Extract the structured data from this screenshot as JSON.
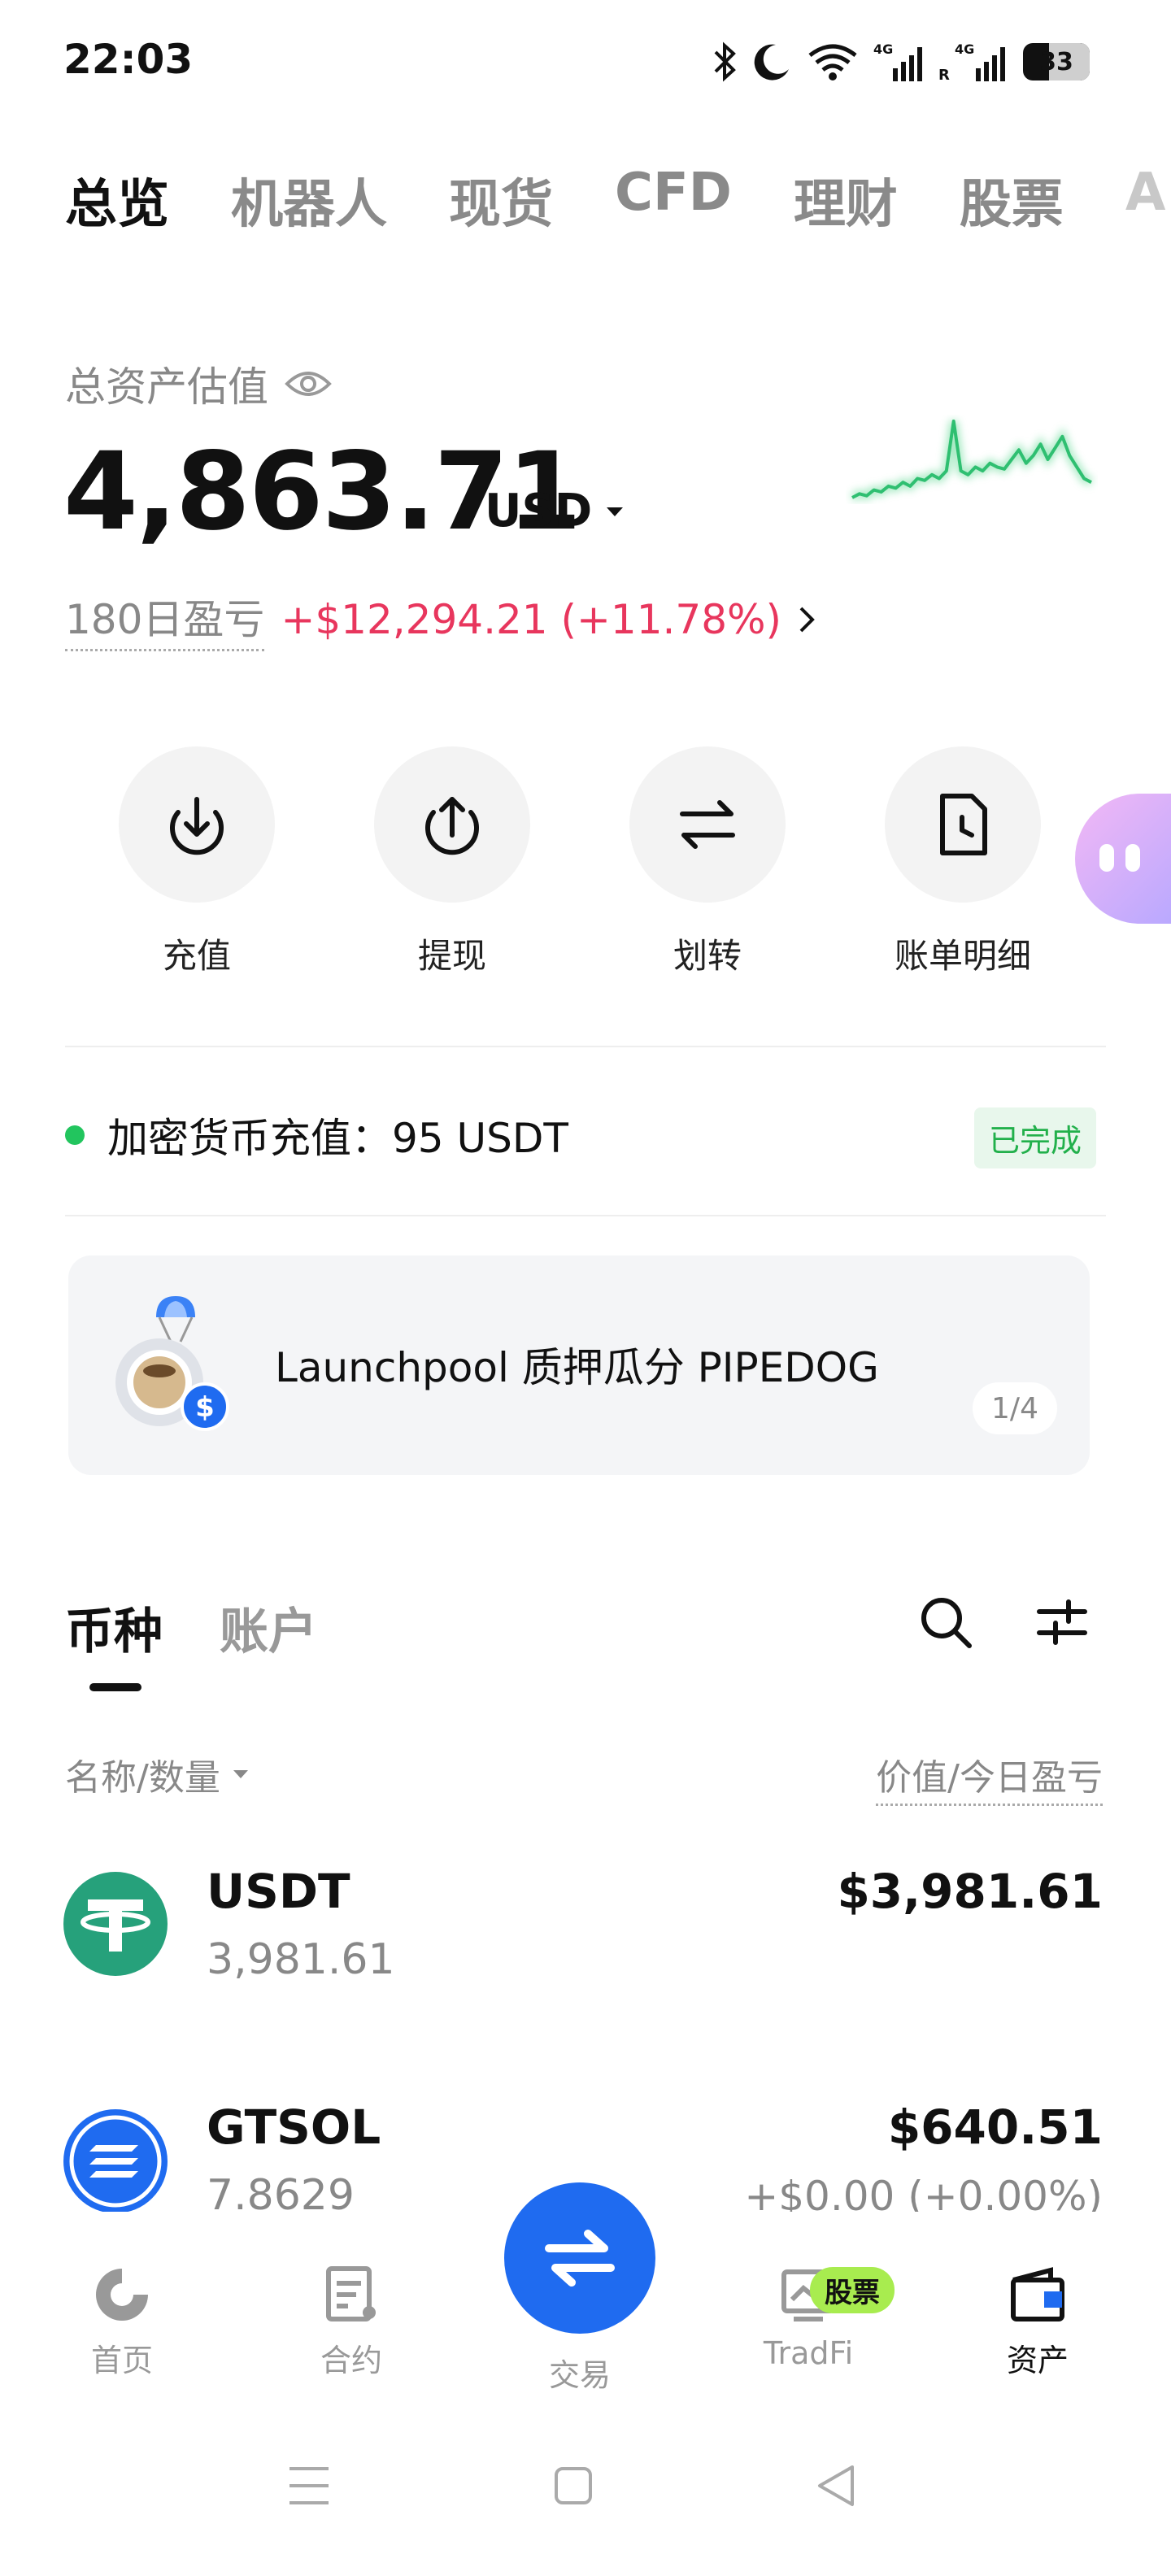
{
  "status_bar": {
    "time": "22:03",
    "battery": "33",
    "icons": [
      "bluetooth-icon",
      "moon-icon",
      "wifi-icon",
      "signal-4g-icon",
      "signal-4g-r-icon",
      "battery-icon"
    ]
  },
  "top_tabs": [
    {
      "label": "总览",
      "active": true
    },
    {
      "label": "机器人",
      "active": false
    },
    {
      "label": "现货",
      "active": false
    },
    {
      "label": "CFD",
      "active": false
    },
    {
      "label": "理财",
      "active": false
    },
    {
      "label": "股票",
      "active": false
    },
    {
      "label": "A",
      "active": false
    }
  ],
  "assets": {
    "label": "总资产估值",
    "value": "4,863.71",
    "currency": "USD",
    "pnl_label": "180日盈亏",
    "pnl_value": "+$12,294.21 (+11.78%)",
    "sparkline_values": [
      30,
      32,
      31,
      34,
      33,
      36,
      35,
      38,
      36,
      40,
      39,
      42,
      40,
      44,
      70,
      44,
      42,
      46,
      44,
      48,
      46,
      45,
      50,
      55,
      48,
      52,
      58,
      50,
      56,
      62,
      52,
      46,
      40,
      38
    ]
  },
  "actions": [
    {
      "label": "充值",
      "icon": "download-icon"
    },
    {
      "label": "提现",
      "icon": "upload-icon"
    },
    {
      "label": "划转",
      "icon": "transfer-icon"
    },
    {
      "label": "账单明细",
      "icon": "bill-icon"
    }
  ],
  "deposit": {
    "text": "加密货币充值：95 USDT",
    "status": "已完成"
  },
  "banner": {
    "text": "Launchpool 质押瓜分 PIPEDOG",
    "page": "1/4"
  },
  "list_tabs": {
    "coin": "币种",
    "account": "账户"
  },
  "columns": {
    "left": "名称/数量",
    "right": "价值/今日盈亏"
  },
  "holdings": [
    {
      "name": "USDT",
      "qty": "3,981.61",
      "value": "$3,981.61",
      "pnl": ""
    },
    {
      "name": "GTSOL",
      "qty": "7.8629",
      "value": "$640.51",
      "pnl": "+$0.00 (+0.00%)"
    }
  ],
  "bottom_nav": {
    "home": "首页",
    "futures": "合约",
    "trade": "交易",
    "tradfi": "TradFi",
    "stock_badge": "股票",
    "assets": "资产"
  },
  "colors": {
    "accent": "#1f6bf0",
    "profit": "#e8365d",
    "success": "#22b04b",
    "sparkline": "#2fbf71"
  }
}
